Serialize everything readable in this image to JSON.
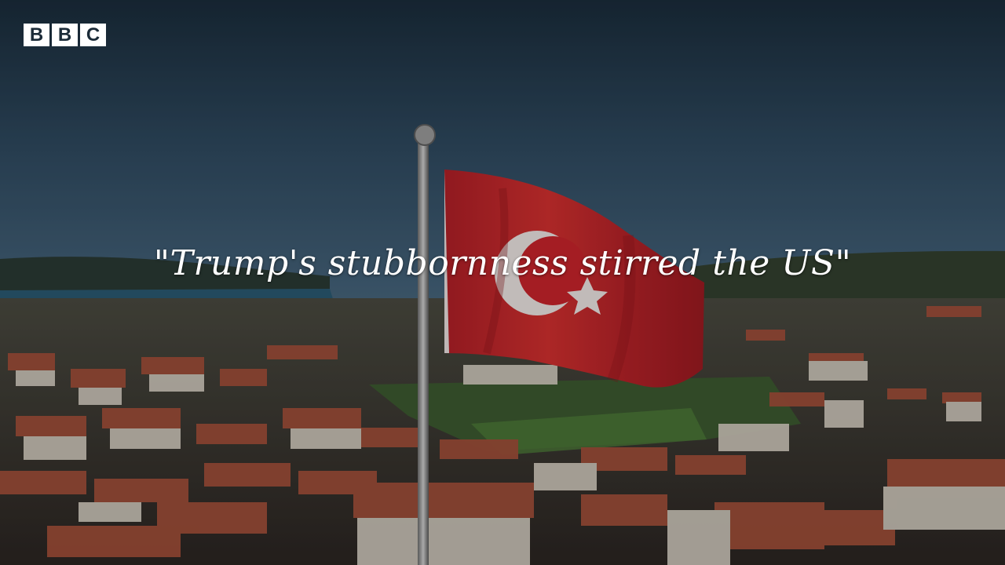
{
  "logo": {
    "letters": [
      "B",
      "B",
      "C"
    ]
  },
  "caption": {
    "text": "\"Trump's stubbornness stirred the US\""
  },
  "colors": {
    "sky_top": "#1d2f3f",
    "sky_bottom": "#41617c",
    "sea": "#2a5a72",
    "flag_red": "#c9242b",
    "roof": "#a14f3a",
    "field": "#3c5a30"
  }
}
